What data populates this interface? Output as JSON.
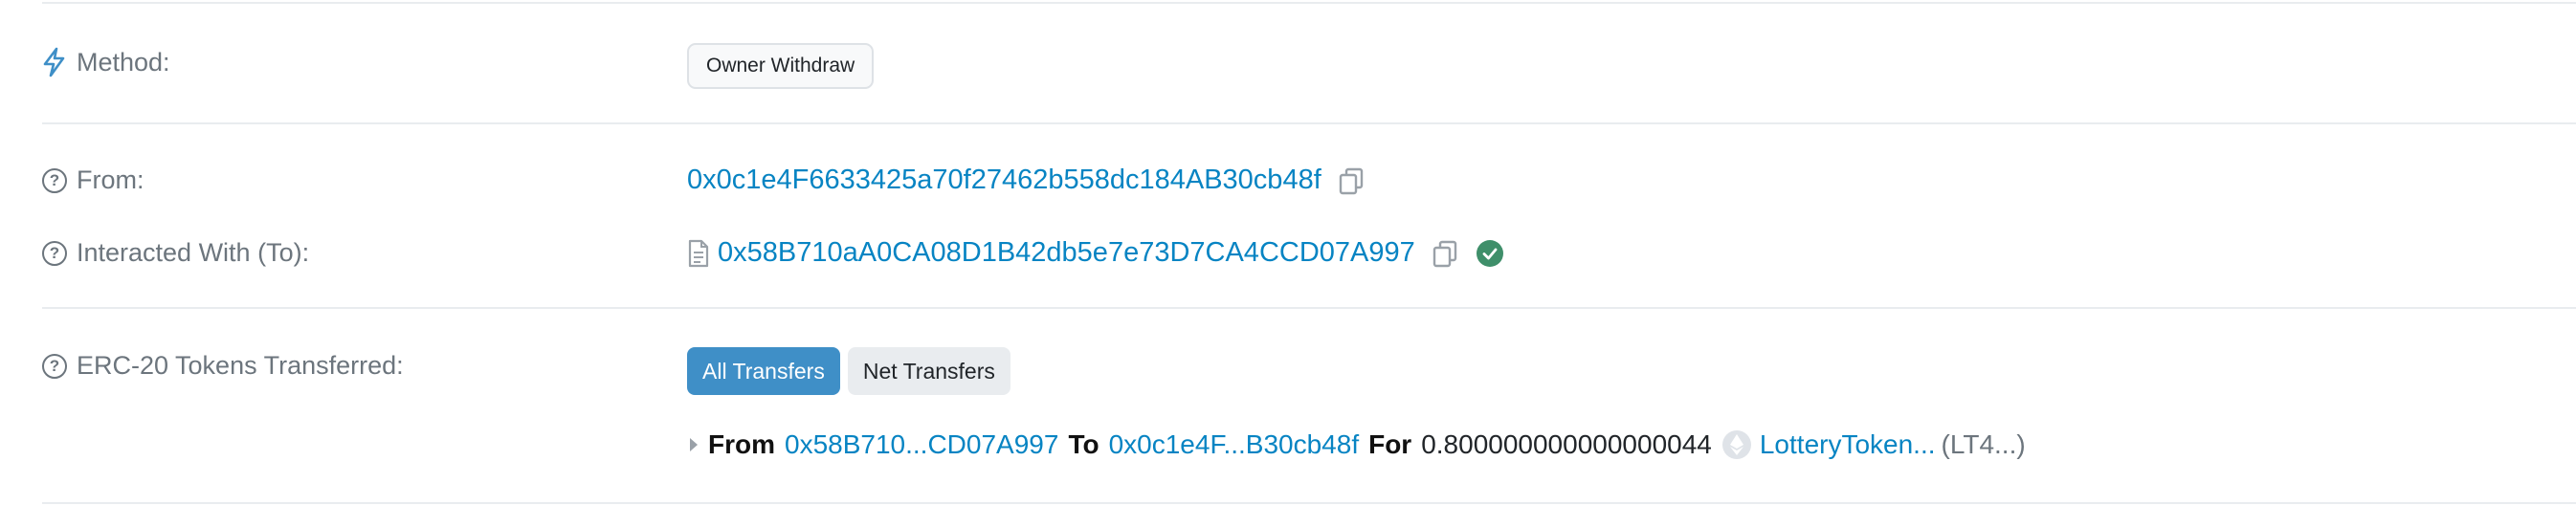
{
  "method": {
    "label": "Method:",
    "badge": "Owner Withdraw"
  },
  "from": {
    "label": "From:",
    "address": "0x0c1e4F6633425a70f27462b558dc184AB30cb48f"
  },
  "to": {
    "label": "Interacted With (To):",
    "address": "0x58B710aA0CA08D1B42db5e7e73D7CA4CCD07A997"
  },
  "tokens": {
    "label": "ERC-20 Tokens Transferred:",
    "tabs": [
      "All Transfers",
      "Net Transfers"
    ],
    "transfer": {
      "from_word": "From",
      "from_address": "0x58B710...CD07A997",
      "to_word": "To",
      "to_address": "0x0c1e4F...B30cb48f",
      "for_word": "For",
      "amount": "0.800000000000000044",
      "token_name": "LotteryToken...",
      "token_symbol": "(LT4...)"
    }
  },
  "colors": {
    "link": "#0784c3",
    "primary_button": "#3f8fc7",
    "verified": "#3f8f6a"
  },
  "icons": [
    "lightning-icon",
    "question-circle-icon",
    "copy-icon",
    "contract-file-icon",
    "verified-check-icon",
    "caret-right-icon",
    "token-logo-icon"
  ]
}
